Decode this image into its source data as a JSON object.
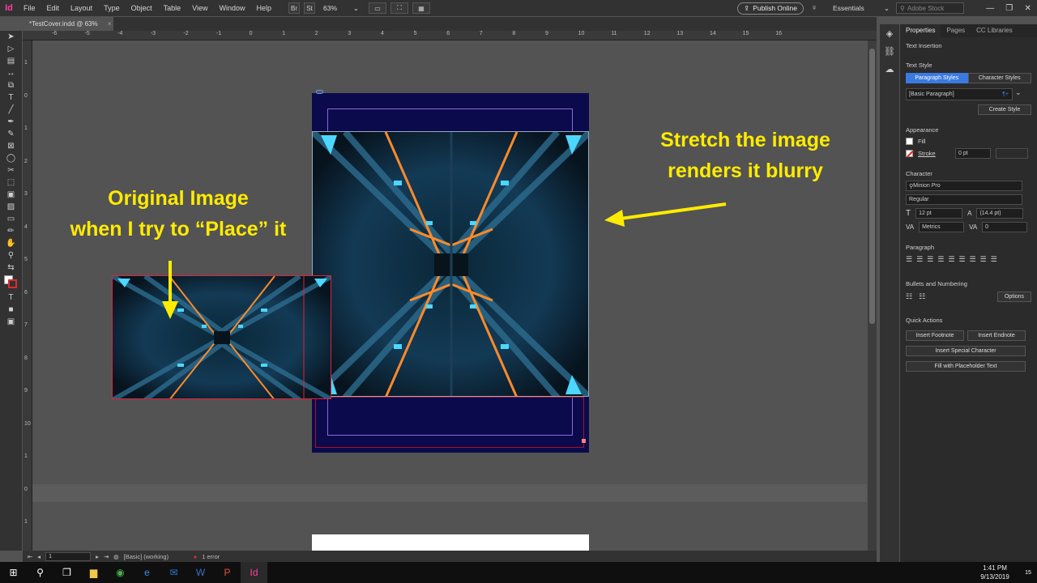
{
  "app": {
    "logo": "Id"
  },
  "menubar": {
    "items": [
      "File",
      "Edit",
      "Layout",
      "Type",
      "Object",
      "Table",
      "View",
      "Window",
      "Help"
    ],
    "br_label": "Br",
    "st_label": "St",
    "zoom": "63%",
    "publish_label": "Publish Online",
    "workspace": "Essentials",
    "search_placeholder": "Adobe Stock"
  },
  "document": {
    "tab_title": "*TestCover.indd @ 63%"
  },
  "ruler": {
    "h_ticks": [
      "-6",
      "-5",
      "-4",
      "-3",
      "-2",
      "-1",
      "0",
      "1",
      "2",
      "3",
      "4",
      "5",
      "6",
      "7",
      "8",
      "9",
      "10",
      "11",
      "12",
      "13",
      "14",
      "15",
      "16"
    ],
    "v_ticks": [
      "1",
      "0",
      "1",
      "2",
      "3",
      "4",
      "5",
      "6",
      "7",
      "8",
      "9",
      "10",
      "1",
      "0",
      "1"
    ]
  },
  "annotations": {
    "left_line1": "Original Image",
    "left_line2": "when I try to “Place” it",
    "right_line1": "Stretch the image",
    "right_line2": "renders it blurry"
  },
  "colors": {
    "annotation": "#ffeb00",
    "page_bg": "#0b0a4d",
    "frame_red": "#e0223c",
    "accent_blue": "#3b7be0"
  },
  "panel": {
    "tabs": [
      "Properties",
      "Pages",
      "CC Libraries"
    ],
    "section_text_insertion": "Text Insertion",
    "section_text_style": "Text Style",
    "style_tabs": [
      "Paragraph Styles",
      "Character Styles"
    ],
    "paragraph_style": "[Basic Paragraph]",
    "create_style": "Create Style",
    "section_appearance": "Appearance",
    "fill_label": "Fill",
    "stroke_label": "Stroke",
    "stroke_value": "0 pt",
    "section_character": "Character",
    "font_family": "Minion Pro",
    "font_style": "Regular",
    "font_size": "12 pt",
    "leading": "(14.4 pt)",
    "kerning": "Metrics",
    "tracking": "0",
    "section_paragraph": "Paragraph",
    "section_bullets": "Bullets and Numbering",
    "options": "Options",
    "section_quick": "Quick Actions",
    "insert_footnote": "Insert Footnote",
    "insert_endnote": "Insert Endnote",
    "insert_special": "Insert Special Character",
    "fill_placeholder": "Fill with Placeholder Text"
  },
  "status": {
    "page": "1",
    "preflight_profile": "[Basic] (working)",
    "errors": "1 error"
  },
  "taskbar": {
    "time": "1:41 PM",
    "date": "9/13/2019",
    "notifications": "15"
  }
}
